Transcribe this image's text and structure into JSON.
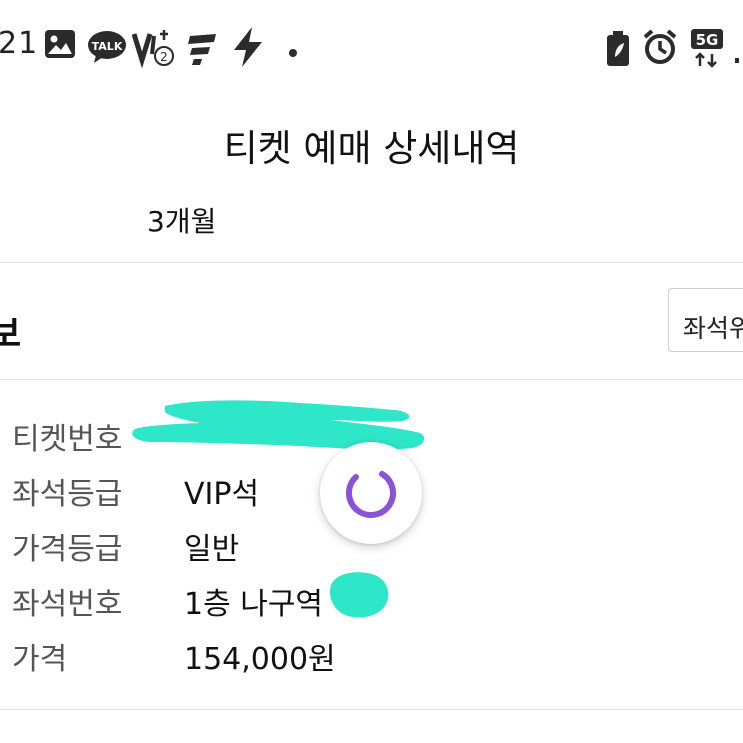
{
  "status_bar": {
    "time_fragment": "21",
    "left_icons": [
      "gallery-icon",
      "kakaotalk-icon",
      "volte-icon",
      "sim-2-icon",
      "kakao-page-icon",
      "flash-icon",
      "dot-icon"
    ],
    "right_icons": [
      "battery-saver-icon",
      "alarm-icon",
      "5g-icon",
      "signal-icon"
    ],
    "talk_label": "TALK",
    "network_label": "5G"
  },
  "header": {
    "title": "티켓 예매 상세내역"
  },
  "filter": {
    "period_label": "3개월"
  },
  "section": {
    "title": "보",
    "seat_button_label": "좌석위"
  },
  "details": [
    {
      "label": "티켓번호",
      "value": ""
    },
    {
      "label": "좌석등급",
      "value": "VIP석"
    },
    {
      "label": "가격등급",
      "value": "일반"
    },
    {
      "label": "좌석번호",
      "value": "1층 나구역"
    },
    {
      "label": "가격",
      "value": "154,000원"
    }
  ],
  "colors": {
    "redaction": "#2ee6c8",
    "spinner": "#8a52d6",
    "divider": "#e2e2e2"
  }
}
